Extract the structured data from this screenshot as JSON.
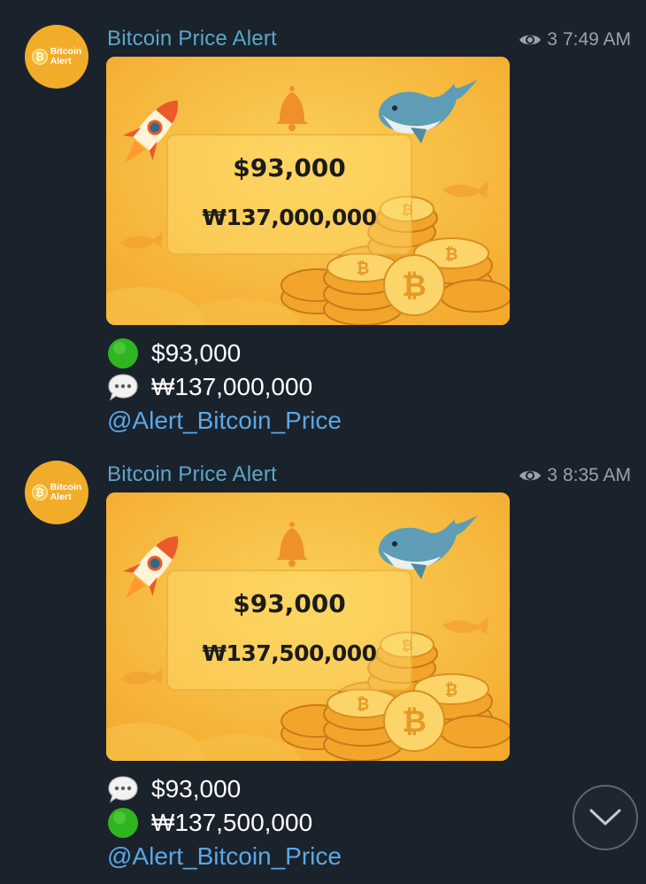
{
  "messages": [
    {
      "sender": "Bitcoin Price Alert",
      "avatar_text_1": "Bitcoin",
      "avatar_text_2": "Alert",
      "avatar_coin": "₿",
      "views": "3",
      "time": "7:49 AM",
      "image": {
        "usd": "$93,000",
        "krw": "₩137,000,000"
      },
      "lines": [
        {
          "icon": "green-circle-icon",
          "text": "$93,000"
        },
        {
          "icon": "speech-bubble-icon",
          "text": "₩137,000,000"
        }
      ],
      "link": "@Alert_Bitcoin_Price"
    },
    {
      "sender": "Bitcoin Price Alert",
      "avatar_text_1": "Bitcoin",
      "avatar_text_2": "Alert",
      "avatar_coin": "₿",
      "views": "3",
      "time": "8:35 AM",
      "image": {
        "usd": "$93,000",
        "krw": "₩137,500,000"
      },
      "lines": [
        {
          "icon": "speech-bubble-icon",
          "text": "$93,000"
        },
        {
          "icon": "green-circle-icon",
          "text": "₩137,500,000"
        }
      ],
      "link": "@Alert_Bitcoin_Price"
    }
  ],
  "colors": {
    "background": "#1a222c",
    "sender": "#5aa8c9",
    "link": "#5aa8e6",
    "meta": "#98a2ad",
    "avatar": "#f1ad2a"
  }
}
